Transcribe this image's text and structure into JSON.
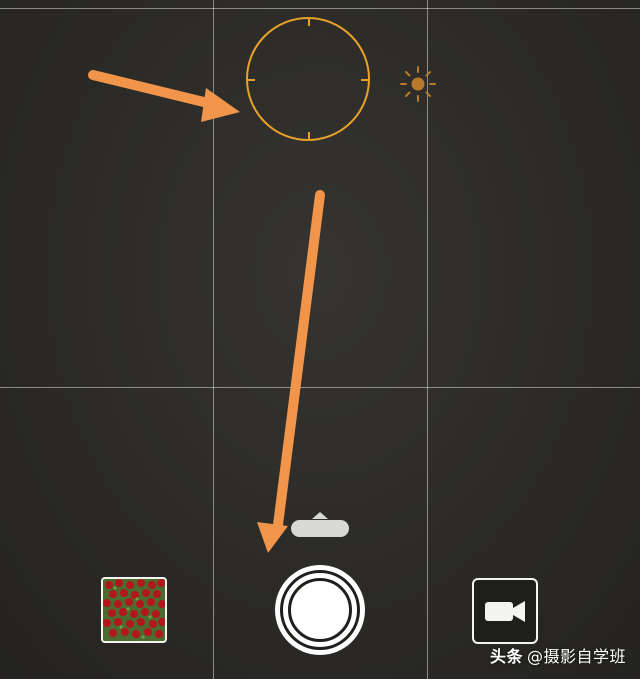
{
  "camera": {
    "focus_color": "#e9a12a",
    "annotation_color": "#f0954a"
  },
  "controls": {
    "shutter_icon": "shutter-icon",
    "video_icon": "video-camera-icon",
    "mode_handle_icon": "chevron-up-icon",
    "thumbnail_icon": "photo-thumbnail"
  },
  "watermark": {
    "logo": "头条",
    "handle": "@摄影自学班"
  }
}
